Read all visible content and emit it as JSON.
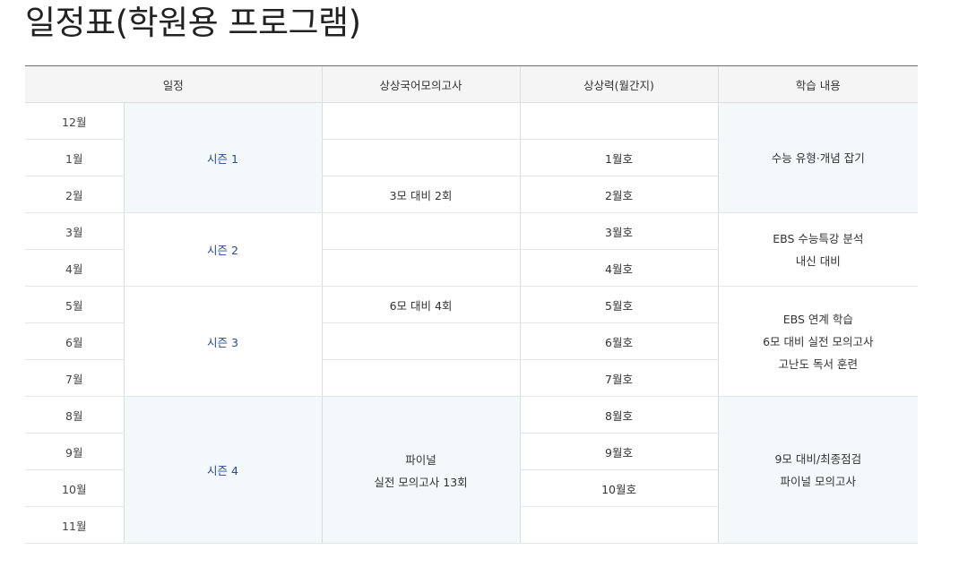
{
  "title": "일정표(학원용 프로그램)",
  "headers": {
    "schedule": "일정",
    "mock_exam": "상상국어모의고사",
    "monthly": "상상력(월간지)",
    "study": "학습 내용"
  },
  "months": [
    "12월",
    "1월",
    "2월",
    "3월",
    "4월",
    "5월",
    "6월",
    "7월",
    "8월",
    "9월",
    "10월",
    "11월"
  ],
  "seasons": [
    "시즌 1",
    "시즌 2",
    "시즌 3",
    "시즌 4"
  ],
  "mock_exam": {
    "feb": "3모 대비 2회",
    "may": "6모 대비 4회",
    "final_line1": "파이널",
    "final_line2": "실전 모의고사 13회"
  },
  "monthly_issues": [
    "1월호",
    "2월호",
    "3월호",
    "4월호",
    "5월호",
    "6월호",
    "7월호",
    "8월호",
    "9월호",
    "10월호"
  ],
  "study": {
    "season1": [
      "수능 유형·개념 잡기"
    ],
    "season2": [
      "EBS 수능특강 분석",
      "내신 대비"
    ],
    "season3": [
      "EBS 연계 학습",
      "6모 대비 실전 모의고사",
      "고난도 독서 훈련"
    ],
    "season4": [
      "9모 대비/최종점검",
      "파이널 모의고사"
    ]
  }
}
